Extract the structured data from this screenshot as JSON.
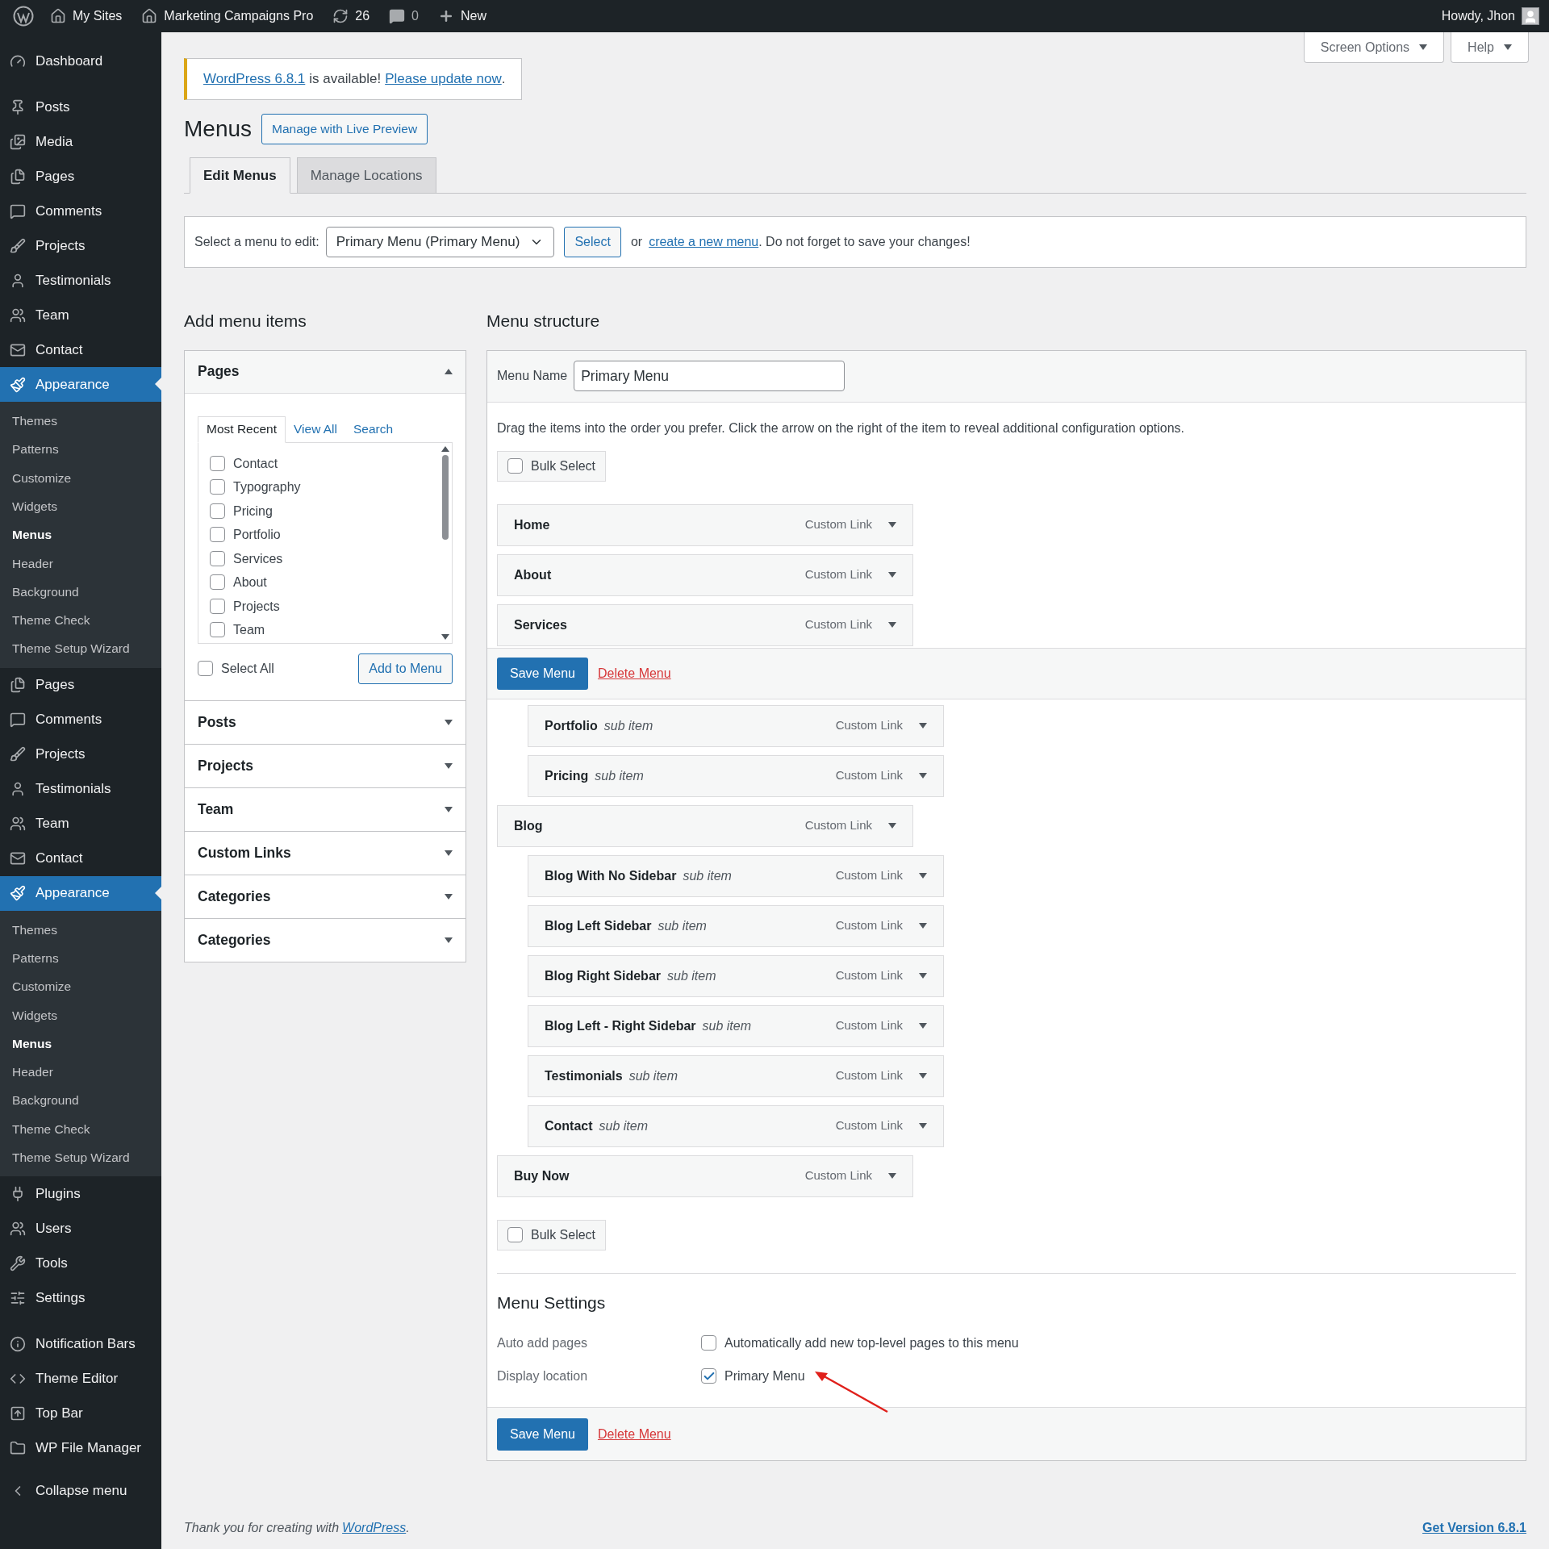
{
  "admin_bar": {
    "items": [
      {
        "label": "My Sites"
      },
      {
        "label": "Marketing Campaigns Pro"
      },
      {
        "label": "26"
      },
      {
        "label": "0"
      },
      {
        "label": "New"
      }
    ],
    "greeting": "Howdy, Jhon"
  },
  "sidebar": {
    "groups": [
      [
        {
          "label": "Dashboard"
        }
      ],
      [
        {
          "label": "Posts"
        },
        {
          "label": "Media"
        },
        {
          "label": "Pages"
        },
        {
          "label": "Comments"
        },
        {
          "label": "Projects"
        },
        {
          "label": "Testimonials"
        },
        {
          "label": "Team"
        },
        {
          "label": "Contact"
        },
        {
          "label": "Appearance",
          "current": true,
          "children": [
            {
              "label": "Themes",
              "selected": false
            },
            {
              "label": "Patterns",
              "selected": false
            },
            {
              "label": "Customize",
              "selected": false
            },
            {
              "label": "Widgets",
              "selected": false
            },
            {
              "label": "Menus",
              "selected": true
            },
            {
              "label": "Header",
              "selected": false
            },
            {
              "label": "Background",
              "selected": false
            },
            {
              "label": "Theme Check",
              "selected": false
            },
            {
              "label": "Theme Setup Wizard",
              "selected": false
            }
          ]
        },
        {
          "label": "Pages"
        },
        {
          "label": "Comments"
        },
        {
          "label": "Projects"
        },
        {
          "label": "Testimonials"
        },
        {
          "label": "Team"
        },
        {
          "label": "Contact"
        },
        {
          "label": "Appearance",
          "current": true,
          "children": [
            {
              "label": "Themes",
              "selected": false
            },
            {
              "label": "Patterns",
              "selected": false
            },
            {
              "label": "Customize",
              "selected": false
            },
            {
              "label": "Widgets",
              "selected": false
            },
            {
              "label": "Menus",
              "selected": true
            },
            {
              "label": "Header",
              "selected": false
            },
            {
              "label": "Background",
              "selected": false
            },
            {
              "label": "Theme Check",
              "selected": false
            },
            {
              "label": "Theme Setup Wizard",
              "selected": false
            }
          ]
        },
        {
          "label": "Plugins"
        },
        {
          "label": "Users"
        },
        {
          "label": "Tools"
        },
        {
          "label": "Settings"
        }
      ],
      [
        {
          "label": "Notification Bars"
        },
        {
          "label": "Theme Editor"
        },
        {
          "label": "Top Bar"
        },
        {
          "label": "WP File Manager"
        }
      ],
      [
        {
          "label": "Collapse menu"
        }
      ]
    ]
  },
  "screen_meta": [
    "Screen Options",
    "Help"
  ],
  "notice": {
    "link": "WordPress 6.8.1",
    "text": "is available!",
    "action": "Please update now",
    "end": "."
  },
  "heading": "Menus",
  "live_preview": "Manage with Live Preview",
  "tabs": [
    {
      "label": "Edit Menus",
      "selected": true
    },
    {
      "label": "Manage Locations",
      "selected": false
    }
  ],
  "select_bar": {
    "label": "Select a menu to edit:",
    "value": "Primary Menu (Primary Menu)",
    "button": "Select",
    "or": "or",
    "link": "create a new menu",
    "after": ". Do not forget to save your changes!"
  },
  "add_items": {
    "title": "Add menu items",
    "panels": [
      {
        "title": "Pages",
        "expanded": true,
        "tabs": [
          {
            "label": "Most Recent",
            "selected": true
          },
          {
            "label": "View All",
            "selected": false
          },
          {
            "label": "Search",
            "selected": false
          }
        ],
        "items": [
          {
            "label": "Contact",
            "checked": false
          },
          {
            "label": "Typography",
            "checked": false
          },
          {
            "label": "Pricing",
            "checked": false
          },
          {
            "label": "Portfolio",
            "checked": false
          },
          {
            "label": "Services",
            "checked": false
          },
          {
            "label": "About",
            "checked": false
          },
          {
            "label": "Projects",
            "checked": false
          },
          {
            "label": "Team",
            "checked": false
          }
        ],
        "select_all": {
          "label": "Select All",
          "checked": false
        },
        "button": "Add to Menu"
      },
      {
        "title": "Posts",
        "expanded": false
      },
      {
        "title": "Projects",
        "expanded": false
      },
      {
        "title": "Team",
        "expanded": false
      },
      {
        "title": "Custom Links",
        "expanded": false
      },
      {
        "title": "Categories",
        "expanded": false
      },
      {
        "title": "Categories",
        "expanded": false
      }
    ]
  },
  "structure": {
    "title": "Menu structure",
    "name_label": "Menu Name",
    "name_value": "Primary Menu",
    "instructions": "Drag the items into the order you prefer. Click the arrow on the right of the item to reveal additional configuration options.",
    "bulk_select": {
      "label": "Bulk Select",
      "checked": false
    },
    "items_before": [
      {
        "title": "Home",
        "type": "Custom Link"
      },
      {
        "title": "About",
        "type": "Custom Link"
      },
      {
        "title": "Services",
        "type": "Custom Link"
      }
    ],
    "actions": {
      "save": "Save Menu",
      "delete": "Delete Menu"
    },
    "items_after": [
      {
        "children": [
          {
            "title": "Portfolio",
            "note": "sub item",
            "type": "Custom Link"
          },
          {
            "title": "Pricing",
            "note": "sub item",
            "type": "Custom Link"
          }
        ]
      },
      {
        "title": "Blog",
        "type": "Custom Link",
        "children": [
          {
            "title": "Blog With No Sidebar",
            "note": "sub item",
            "type": "Custom Link"
          },
          {
            "title": "Blog Left Sidebar",
            "note": "sub item",
            "type": "Custom Link"
          },
          {
            "title": "Blog Right Sidebar",
            "note": "sub item",
            "type": "Custom Link"
          },
          {
            "title": "Blog Left - Right Sidebar",
            "note": "sub item",
            "type": "Custom Link"
          },
          {
            "title": "Testimonials",
            "note": "sub item",
            "type": "Custom Link"
          },
          {
            "title": "Contact",
            "note": "sub item",
            "type": "Custom Link"
          }
        ]
      },
      {
        "title": "Buy Now",
        "type": "Custom Link"
      }
    ],
    "bulk_select_bottom": {
      "label": "Bulk Select",
      "checked": false
    },
    "settings": {
      "title": "Menu Settings",
      "rows": [
        {
          "label": "Auto add pages",
          "option": "Automatically add new top-level pages to this menu",
          "checked": false
        },
        {
          "label": "Display location",
          "option": "Primary Menu",
          "checked": true
        }
      ]
    },
    "footer_actions": {
      "save": "Save Menu",
      "delete": "Delete Menu"
    }
  },
  "footer": {
    "text": "Thank you for creating with",
    "link": "WordPress",
    "end": ".",
    "version": "Get Version 6.8.1"
  }
}
